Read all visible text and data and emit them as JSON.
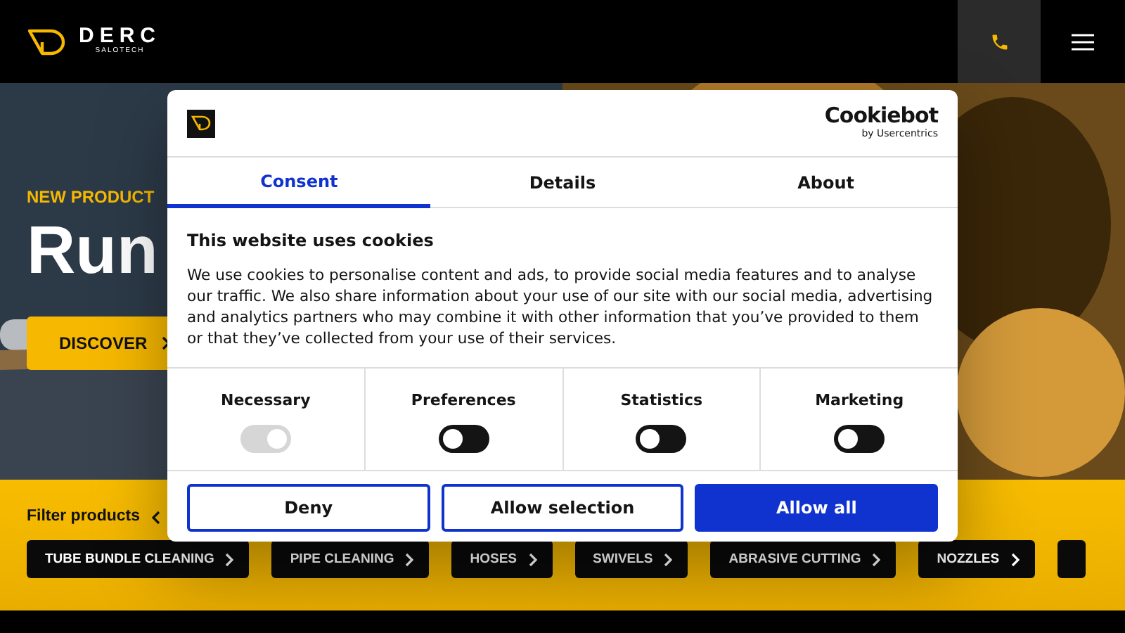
{
  "header": {
    "brand": "DERC",
    "brand_sub": "SALOTECH"
  },
  "hero": {
    "eyebrow": "NEW PRODUCT",
    "title": "Run",
    "button": "DISCOVER"
  },
  "filter": {
    "label": "Filter products",
    "chips": [
      {
        "label": "TUBE BUNDLE CLEANING"
      },
      {
        "label": "PIPE CLEANING"
      },
      {
        "label": "HOSES"
      },
      {
        "label": "SWIVELS"
      },
      {
        "label": "ABRASIVE CUTTING"
      },
      {
        "label": "NOZZLES"
      }
    ]
  },
  "dialog": {
    "provider": "Cookiebot",
    "provider_sub": "by Usercentrics",
    "tabs": [
      {
        "label": "Consent",
        "selected": true
      },
      {
        "label": "Details",
        "selected": false
      },
      {
        "label": "About",
        "selected": false
      }
    ],
    "heading": "This website uses cookies",
    "body": "We use cookies to personalise content and ads, to provide social media features and to analyse our traffic. We also share information about your use of our site with our social media, advertising and analytics partners who may combine it with other information that you’ve provided to them or that they’ve collected from your use of their services.",
    "categories": [
      {
        "label": "Necessary",
        "checked": true,
        "disabled": true
      },
      {
        "label": "Preferences",
        "checked": false,
        "disabled": false
      },
      {
        "label": "Statistics",
        "checked": false,
        "disabled": false
      },
      {
        "label": "Marketing",
        "checked": false,
        "disabled": false
      }
    ],
    "buttons": [
      {
        "label": "Deny",
        "kind": "outline"
      },
      {
        "label": "Allow selection",
        "kind": "outline"
      },
      {
        "label": "Allow all",
        "kind": "primary"
      }
    ]
  }
}
